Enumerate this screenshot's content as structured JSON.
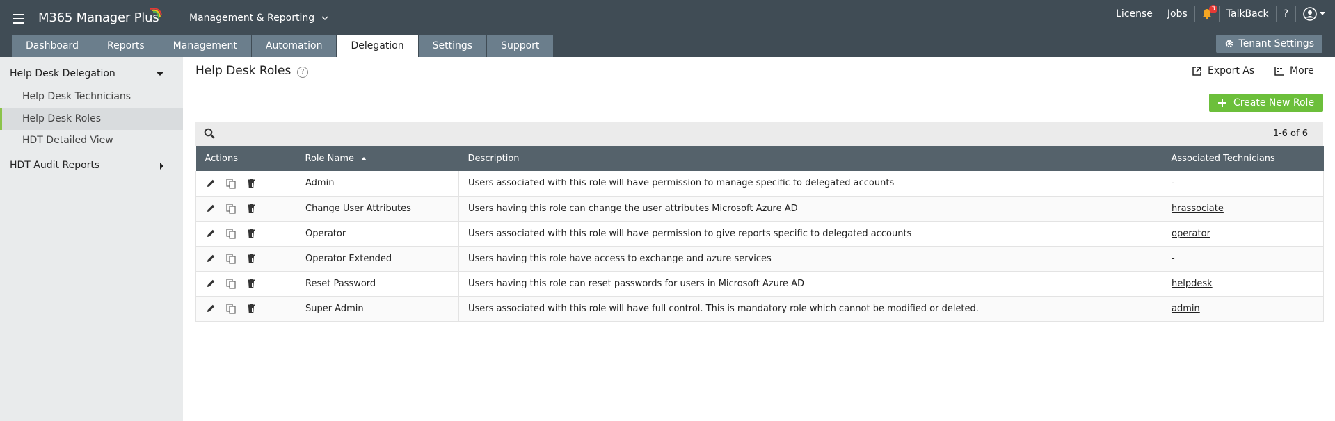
{
  "header": {
    "brand": "M365 Manager Plus",
    "module": "Management & Reporting",
    "links": {
      "license": "License",
      "jobs": "Jobs",
      "talkback": "TalkBack",
      "help": "?"
    },
    "notification_count": "3"
  },
  "tabs": [
    {
      "label": "Dashboard"
    },
    {
      "label": "Reports"
    },
    {
      "label": "Management"
    },
    {
      "label": "Automation"
    },
    {
      "label": "Delegation",
      "active": true
    },
    {
      "label": "Settings"
    },
    {
      "label": "Support"
    }
  ],
  "tenant_settings_label": "Tenant Settings",
  "sidebar": {
    "group1": "Help Desk Delegation",
    "items": [
      {
        "label": "Help Desk Technicians"
      },
      {
        "label": "Help Desk Roles",
        "active": true
      },
      {
        "label": "HDT Detailed View"
      }
    ],
    "group2": "HDT Audit Reports"
  },
  "page": {
    "title": "Help Desk Roles",
    "export_label": "Export As",
    "more_label": "More",
    "create_label": "Create New Role",
    "pager": "1-6 of 6"
  },
  "table": {
    "columns": [
      "Actions",
      "Role Name",
      "Description",
      "Associated Technicians"
    ],
    "rows": [
      {
        "role": "Admin",
        "description": "Users associated with this role will have permission to manage specific to delegated accounts",
        "tech": "-"
      },
      {
        "role": "Change User Attributes",
        "description": "Users having this role can change the user attributes Microsoft Azure AD",
        "tech": "hrassociate"
      },
      {
        "role": "Operator",
        "description": "Users associated with this role will have permission to give reports specific to delegated accounts",
        "tech": "operator"
      },
      {
        "role": "Operator Extended",
        "description": "Users having this role have access to exchange and azure services",
        "tech": "-"
      },
      {
        "role": "Reset Password",
        "description": "Users having this role can reset passwords for users in Microsoft Azure AD",
        "tech": "helpdesk"
      },
      {
        "role": "Super Admin",
        "description": "Users associated with this role will have full control. This is mandatory role which cannot be modified or deleted.",
        "tech": "admin"
      }
    ]
  },
  "colors": {
    "header_bg": "#404c55",
    "tab_bg": "#6b7e8c",
    "accent_green": "#6cbf3b",
    "table_header_bg": "#55626b",
    "sidebar_bg": "#e9ebec"
  }
}
